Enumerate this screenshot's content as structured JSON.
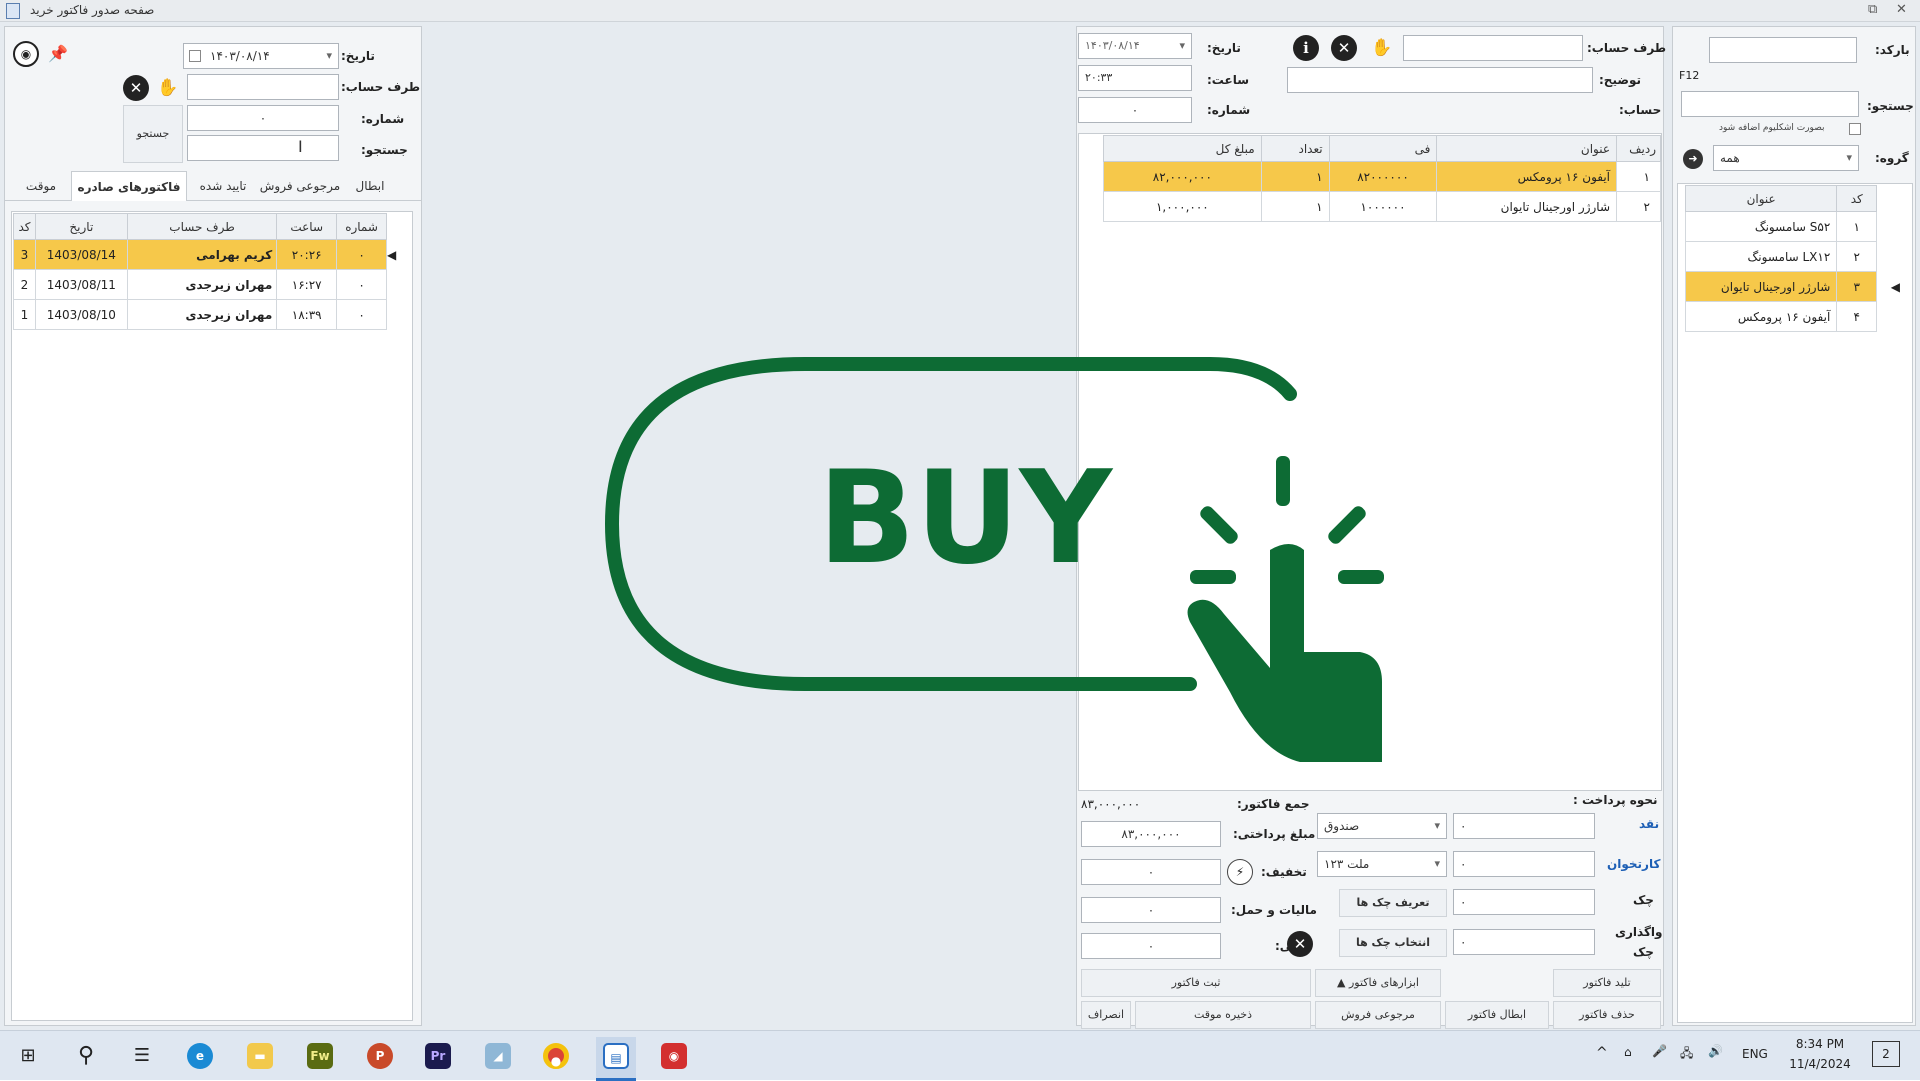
{
  "window": {
    "title": "صفحه صدور فاکتور خرید",
    "min": "⧉",
    "close": "✕"
  },
  "left_panel": {
    "date_label": "تاریخ:",
    "date_value": "۱۴۰۳/۰۸/۱۴",
    "party_label": "طرف حساب:",
    "party_value": "",
    "number_label": "شماره:",
    "number_value": "۰",
    "search_label": "جستجو:",
    "search_value": "",
    "search_button": "جستجو",
    "tabs": [
      "ابطال",
      "مرجوعی فروش",
      "تایید شده",
      "فاکتورهای صادره",
      "موقت"
    ],
    "columns": [
      "شماره",
      "ساعت",
      "طرف حساب",
      "تاریخ",
      "کد"
    ],
    "rows": [
      {
        "num": "۰",
        "time": "۲۰:۲۶",
        "party": "کریم بهرامی",
        "date": "1403/08/14",
        "code": "3"
      },
      {
        "num": "۰",
        "time": "۱۶:۲۷",
        "party": "مهران زیرجدی",
        "date": "1403/08/11",
        "code": "2"
      },
      {
        "num": "۰",
        "time": "۱۸:۳۹",
        "party": "مهران زیرجدی",
        "date": "1403/08/10",
        "code": "1"
      }
    ]
  },
  "invoice": {
    "party_label": "طرف حساب:",
    "party_value": "",
    "desc_label": "توضیح:",
    "desc_value": "",
    "account_label": "حساب:",
    "date_label": "تاریخ:",
    "date_value": "۱۴۰۳/۰۸/۱۴",
    "time_label": "ساعت:",
    "time_value": "۲۰:۳۳",
    "number_label": "شماره:",
    "number_value": "۰",
    "columns": [
      "ردیف",
      "عنوان",
      "فی",
      "تعداد",
      "مبلغ کل"
    ],
    "items": [
      {
        "row": "۱",
        "title": "آیفون ۱۶ پرومکس",
        "price": "۸۲۰۰۰۰۰۰",
        "qty": "۱",
        "total": "۸۲,۰۰۰,۰۰۰"
      },
      {
        "row": "۲",
        "title": "شارژر اورجینال تایوان",
        "price": "۱۰۰۰۰۰۰",
        "qty": "۱",
        "total": "۱,۰۰۰,۰۰۰"
      }
    ]
  },
  "totals": {
    "sum_label": "جمع فاکتور:",
    "sum_value": "۸۳,۰۰۰,۰۰۰",
    "paid_label": "مبلغ پرداختی:",
    "paid_value": "۸۳,۰۰۰,۰۰۰",
    "discount_label": "تخفیف:",
    "discount_value": "۰",
    "tax_label": "مالیات و حمل:",
    "tax_value": "۰",
    "debt_label": "بدهی:",
    "debt_value": "۰"
  },
  "payment": {
    "title": "نحوه پرداخت :",
    "cash_label": "نقد",
    "cash_select": "صندوق",
    "cash_value": "۰",
    "card_label": "کارتخوان",
    "card_select": "ملت ۱۲۳",
    "card_value": "۰",
    "cheque_label": "چک",
    "cheque_btn": "تعریف چک ها",
    "cheque_value": "۰",
    "assign_label1": "واگذاری",
    "assign_label2": "چک",
    "assign_btn": "انتخاب چک ها",
    "assign_value": "۰"
  },
  "buttons": {
    "register": "ثبت فاکتور",
    "tools": "ابزارهای فاکتور",
    "duplicate": "تلید فاکتور",
    "cancel": "انصراف",
    "save_temp": "ذخیره موقت",
    "return_sale": "مرجوعی فروش",
    "void": "ابطال فاکتور",
    "delete": "حذف فاکتور"
  },
  "right_panel": {
    "barcode_label": "بارکد:",
    "barcode_value": "",
    "f12": "F12",
    "search_label": "جستجو:",
    "search_value": "",
    "one_unit_label": "بصورت اشکلیوم اضافه شود",
    "group_label": "گروه:",
    "group_value": "همه",
    "columns": [
      "کد",
      "عنوان"
    ],
    "products": [
      {
        "code": "۱",
        "title": "سامسونگ S۵۲"
      },
      {
        "code": "۲",
        "title": "سامسونگ LX۱۲"
      },
      {
        "code": "۳",
        "title": "شارژر اورجینال تایوان"
      },
      {
        "code": "۴",
        "title": "آیفون ۱۶ پرومکس"
      }
    ]
  },
  "overlay": {
    "text": "BUY",
    "color": "#0d6b34"
  },
  "taskbar": {
    "apps": [
      "start-icon",
      "search-icon",
      "task-view-icon",
      "edge-icon",
      "explorer-icon",
      "fireworks-icon",
      "powerpoint-icon",
      "premiere-icon",
      "photos-icon",
      "chrome-icon",
      "accounting-app-icon",
      "recorder-icon"
    ],
    "fw": "Fw",
    "pr": "Pr",
    "lang": "ENG",
    "time": "8:34 PM",
    "date": "11/4/2024",
    "notif": "2"
  }
}
